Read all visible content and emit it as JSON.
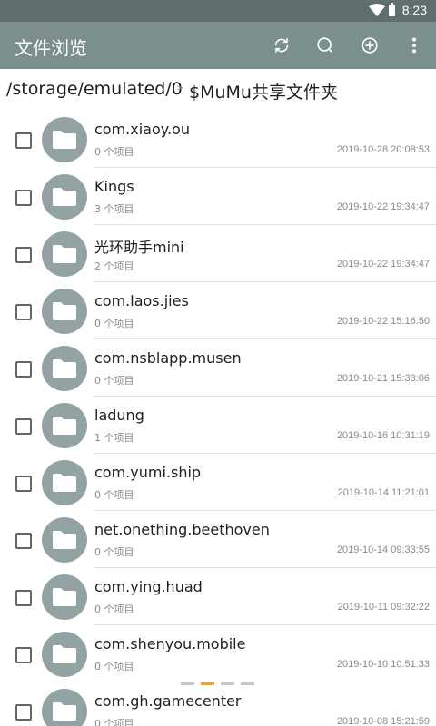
{
  "status_bar": {
    "time": "8:23"
  },
  "toolbar": {
    "title": "文件浏览",
    "icons": [
      "refresh-icon",
      "search-icon",
      "add-icon",
      "more-vert-icon"
    ]
  },
  "path": {
    "root": "/storage/emulated/0",
    "separator": ">",
    "current": "$MuMu共享文件夹"
  },
  "files": [
    {
      "name": "com.xiaoy.ou",
      "count": "0 个项目",
      "date": "2019-10-28 20:08:53"
    },
    {
      "name": "Kings",
      "count": "3 个项目",
      "date": "2019-10-22 19:34:47"
    },
    {
      "name": "光环助手mini",
      "count": "2 个项目",
      "date": "2019-10-22 19:34:47"
    },
    {
      "name": "com.laos.jies",
      "count": "0 个项目",
      "date": "2019-10-22 15:16:50"
    },
    {
      "name": "com.nsblapp.musen",
      "count": "0 个项目",
      "date": "2019-10-21 15:33:06"
    },
    {
      "name": "ladung",
      "count": "1 个项目",
      "date": "2019-10-16 10:31:19"
    },
    {
      "name": "com.yumi.ship",
      "count": "0 个项目",
      "date": "2019-10-14 11:21:01"
    },
    {
      "name": "net.onething.beethoven",
      "count": "0 个项目",
      "date": "2019-10-14 09:33:55"
    },
    {
      "name": "com.ying.huad",
      "count": "0 个项目",
      "date": "2019-10-11 09:32:22"
    },
    {
      "name": "com.shenyou.mobile",
      "count": "0 个项目",
      "date": "2019-10-10 10:51:33"
    },
    {
      "name": "com.gh.gamecenter",
      "count": "0 个项目",
      "date": "2019-10-08 15:21:59"
    }
  ],
  "colors": {
    "status_bar": "#5f6f6f",
    "toolbar": "#7b8f8f",
    "folder_avatar": "#93a3a3",
    "pager_active": "#f0a030",
    "pager_inactive": "#c7c7c7"
  },
  "pager": {
    "pages": 4,
    "active": 2
  }
}
